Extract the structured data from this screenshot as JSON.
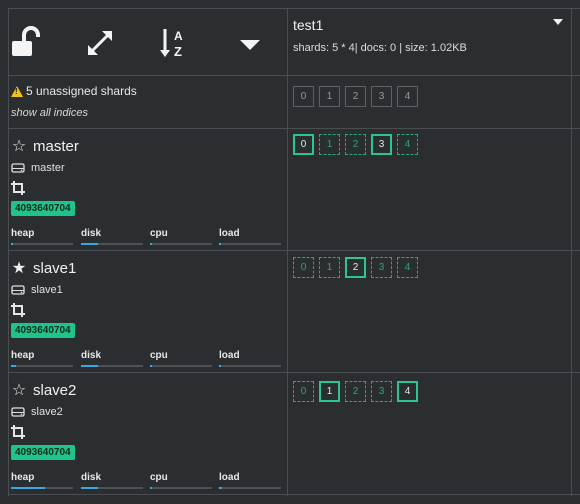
{
  "toolbar": {
    "icons": [
      "unlock-icon",
      "expand-icon",
      "sort-alpha-icon",
      "caret-down-icon"
    ]
  },
  "index": {
    "name": "test1",
    "meta": "shards: 5 * 4| docs: 0 | size: 1.02KB"
  },
  "unassigned": {
    "warning": "5 unassigned shards",
    "show_all": "show all indices",
    "shards": [
      "0",
      "1",
      "2",
      "3",
      "4"
    ]
  },
  "metric_labels": [
    "heap",
    "disk",
    "cpu",
    "load"
  ],
  "colors": {
    "badge": "#1ec58a",
    "primary_shard": "#2ec490",
    "replica_shard": "#2aa67a",
    "metric_bar": "#3aa8e0",
    "warning": "#f0c419"
  },
  "nodes": [
    {
      "name": "master",
      "host": "master",
      "id": "4093640704",
      "starred": false,
      "metrics": {
        "heap": 0.03,
        "disk": 0.28,
        "cpu": 0.01,
        "load": 0.02
      },
      "shards": [
        {
          "num": "0",
          "kind": "primary"
        },
        {
          "num": "1",
          "kind": "replica"
        },
        {
          "num": "2",
          "kind": "replica"
        },
        {
          "num": "3",
          "kind": "primary"
        },
        {
          "num": "4",
          "kind": "replica"
        }
      ]
    },
    {
      "name": "slave1",
      "host": "slave1",
      "id": "4093640704",
      "starred": true,
      "metrics": {
        "heap": 0.08,
        "disk": 0.28,
        "cpu": 0.01,
        "load": 0.02
      },
      "shards": [
        {
          "num": "0",
          "kind": "replica"
        },
        {
          "num": "1",
          "kind": "replica"
        },
        {
          "num": "2",
          "kind": "primary"
        },
        {
          "num": "3",
          "kind": "replica"
        },
        {
          "num": "4",
          "kind": "replica"
        }
      ]
    },
    {
      "name": "slave2",
      "host": "slave2",
      "id": "4093640704",
      "starred": false,
      "metrics": {
        "heap": 0.55,
        "disk": 0.28,
        "cpu": 0.01,
        "load": 0.05
      },
      "shards": [
        {
          "num": "0",
          "kind": "replica"
        },
        {
          "num": "1",
          "kind": "primary"
        },
        {
          "num": "2",
          "kind": "replica"
        },
        {
          "num": "3",
          "kind": "replica"
        },
        {
          "num": "4",
          "kind": "primary"
        }
      ]
    }
  ]
}
